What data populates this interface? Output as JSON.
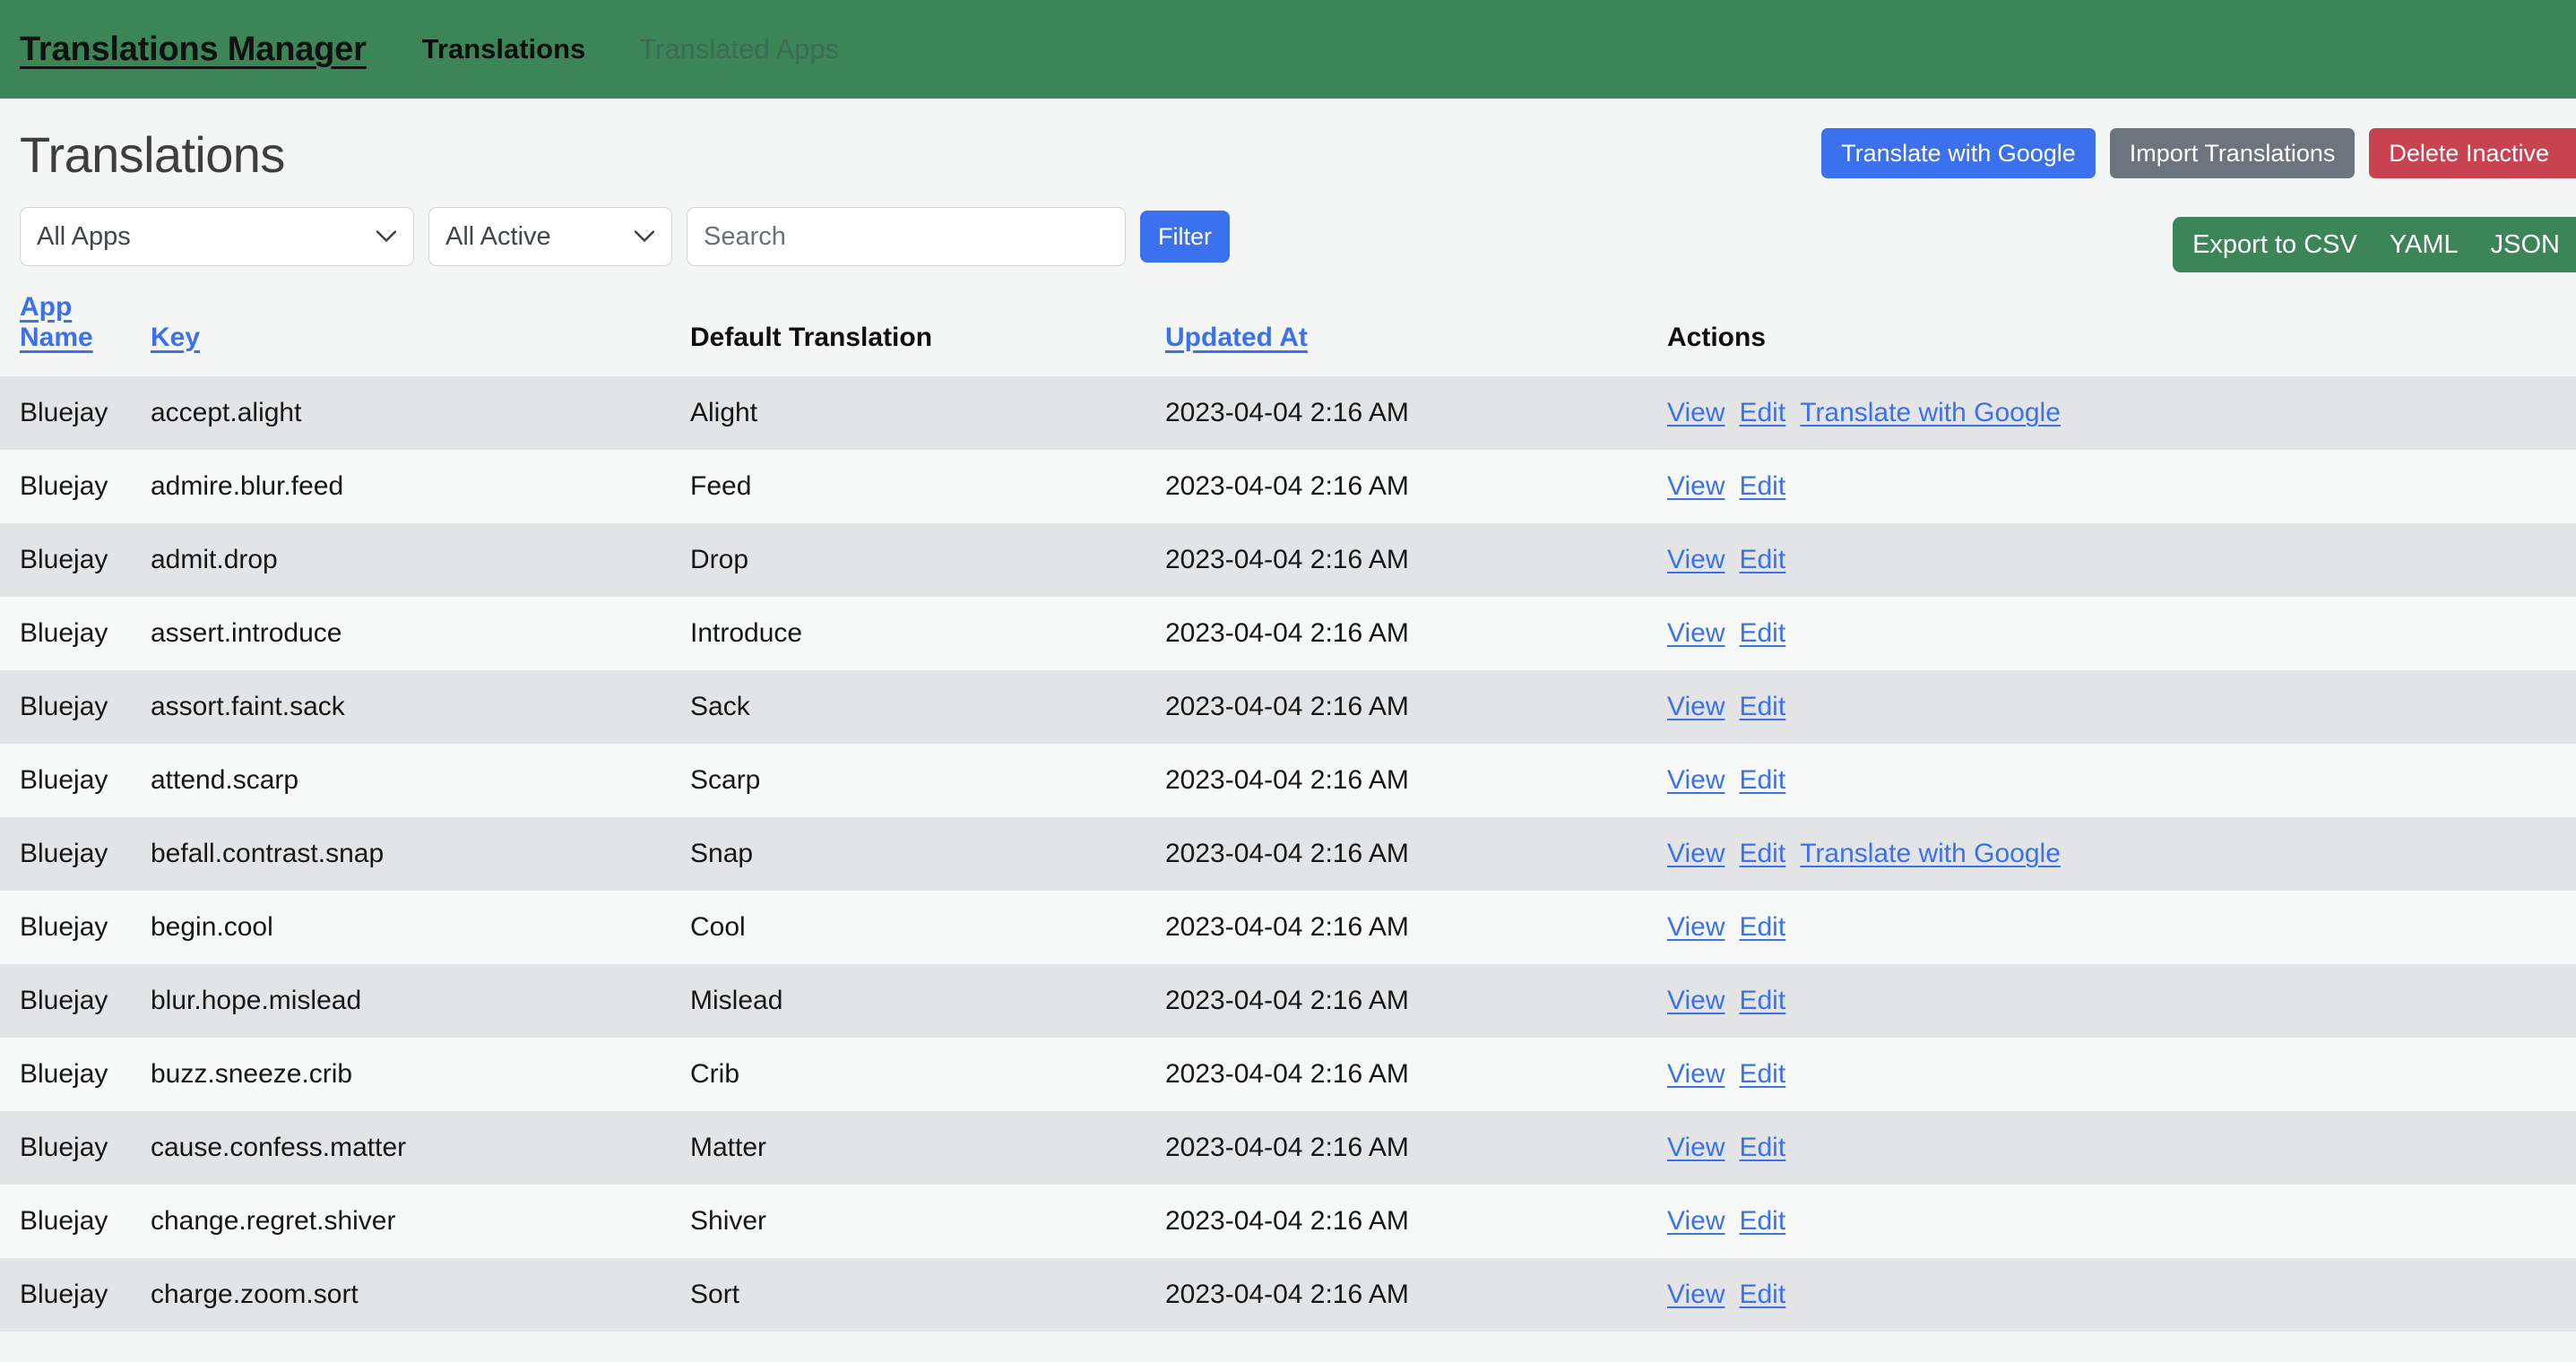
{
  "navbar": {
    "brand": "Translations Manager",
    "links": [
      {
        "label": "Translations",
        "active": true
      },
      {
        "label": "Translated Apps",
        "active": false
      }
    ],
    "background_color": "#3C8557"
  },
  "header": {
    "title": "Translations",
    "buttons": [
      {
        "label": "Translate with Google",
        "color": "#3B71EE"
      },
      {
        "label": "Import Translations",
        "color": "#6C757D"
      },
      {
        "label": "Delete Inactive",
        "color": "#C8424F"
      }
    ]
  },
  "filters": {
    "app_select": {
      "value": "All Apps",
      "options": [
        "All Apps"
      ]
    },
    "status_select": {
      "value": "All Active",
      "options": [
        "All Active"
      ]
    },
    "search": {
      "value": "",
      "placeholder": "Search"
    },
    "filter_button": "Filter",
    "export": {
      "csv_label": "Export to CSV",
      "yaml_label": "YAML",
      "json_label": "JSON",
      "color": "#3C8557"
    }
  },
  "table": {
    "columns": [
      {
        "label": "App Name",
        "sortable": true
      },
      {
        "label": "Key",
        "sortable": true
      },
      {
        "label": "Default Translation",
        "sortable": false
      },
      {
        "label": "Updated At",
        "sortable": true
      },
      {
        "label": "Actions",
        "sortable": false
      }
    ],
    "action_labels": {
      "view": "View",
      "edit": "Edit",
      "translate": "Translate with Google"
    },
    "rows": [
      {
        "app": "Bluejay",
        "key": "accept.alight",
        "default": "Alight",
        "updated": "2023-04-04 2:16 AM",
        "actions": [
          "View",
          "Edit",
          "Translate with Google"
        ]
      },
      {
        "app": "Bluejay",
        "key": "admire.blur.feed",
        "default": "Feed",
        "updated": "2023-04-04 2:16 AM",
        "actions": [
          "View",
          "Edit"
        ]
      },
      {
        "app": "Bluejay",
        "key": "admit.drop",
        "default": "Drop",
        "updated": "2023-04-04 2:16 AM",
        "actions": [
          "View",
          "Edit"
        ]
      },
      {
        "app": "Bluejay",
        "key": "assert.introduce",
        "default": "Introduce",
        "updated": "2023-04-04 2:16 AM",
        "actions": [
          "View",
          "Edit"
        ]
      },
      {
        "app": "Bluejay",
        "key": "assort.faint.sack",
        "default": "Sack",
        "updated": "2023-04-04 2:16 AM",
        "actions": [
          "View",
          "Edit"
        ]
      },
      {
        "app": "Bluejay",
        "key": "attend.scarp",
        "default": "Scarp",
        "updated": "2023-04-04 2:16 AM",
        "actions": [
          "View",
          "Edit"
        ]
      },
      {
        "app": "Bluejay",
        "key": "befall.contrast.snap",
        "default": "Snap",
        "updated": "2023-04-04 2:16 AM",
        "actions": [
          "View",
          "Edit",
          "Translate with Google"
        ]
      },
      {
        "app": "Bluejay",
        "key": "begin.cool",
        "default": "Cool",
        "updated": "2023-04-04 2:16 AM",
        "actions": [
          "View",
          "Edit"
        ]
      },
      {
        "app": "Bluejay",
        "key": "blur.hope.mislead",
        "default": "Mislead",
        "updated": "2023-04-04 2:16 AM",
        "actions": [
          "View",
          "Edit"
        ]
      },
      {
        "app": "Bluejay",
        "key": "buzz.sneeze.crib",
        "default": "Crib",
        "updated": "2023-04-04 2:16 AM",
        "actions": [
          "View",
          "Edit"
        ]
      },
      {
        "app": "Bluejay",
        "key": "cause.confess.matter",
        "default": "Matter",
        "updated": "2023-04-04 2:16 AM",
        "actions": [
          "View",
          "Edit"
        ]
      },
      {
        "app": "Bluejay",
        "key": "change.regret.shiver",
        "default": "Shiver",
        "updated": "2023-04-04 2:16 AM",
        "actions": [
          "View",
          "Edit"
        ]
      },
      {
        "app": "Bluejay",
        "key": "charge.zoom.sort",
        "default": "Sort",
        "updated": "2023-04-04 2:16 AM",
        "actions": [
          "View",
          "Edit"
        ]
      }
    ]
  }
}
